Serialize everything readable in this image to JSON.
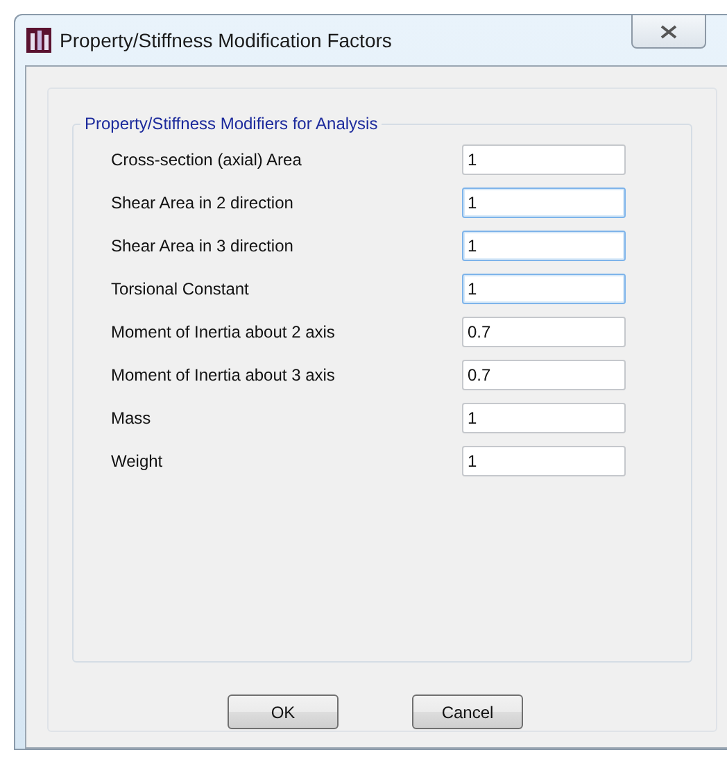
{
  "window": {
    "title": "Property/Stiffness Modification Factors"
  },
  "group": {
    "title": "Property/Stiffness Modifiers for Analysis"
  },
  "fields": [
    {
      "label": "Cross-section (axial) Area",
      "value": "1",
      "highlighted": false
    },
    {
      "label": "Shear Area in 2 direction",
      "value": "1",
      "highlighted": true
    },
    {
      "label": "Shear Area in 3 direction",
      "value": "1",
      "highlighted": true
    },
    {
      "label": "Torsional Constant",
      "value": "1",
      "highlighted": true
    },
    {
      "label": "Moment of Inertia about 2 axis",
      "value": "0.7",
      "highlighted": false
    },
    {
      "label": "Moment of Inertia about 3 axis",
      "value": "0.7",
      "highlighted": false
    },
    {
      "label": "Mass",
      "value": "1",
      "highlighted": false
    },
    {
      "label": "Weight",
      "value": "1",
      "highlighted": false
    }
  ],
  "buttons": [
    "OK",
    "Cancel"
  ]
}
